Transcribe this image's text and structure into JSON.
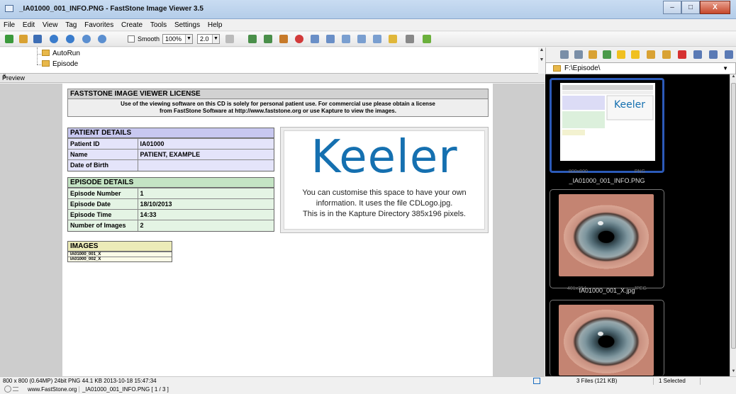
{
  "window": {
    "title": "_IA01000_001_INFO.PNG - FastStone Image Viewer 3.5",
    "min_label": "–",
    "max_label": "□",
    "close_label": "X"
  },
  "menu": [
    "File",
    "Edit",
    "View",
    "Tag",
    "Favorites",
    "Create",
    "Tools",
    "Settings",
    "Help"
  ],
  "toolbar": {
    "smooth_label": "Smooth",
    "zoom_value": "100%",
    "gamma_value": "2.0"
  },
  "tree": {
    "items": [
      "AutoRun",
      "Episode"
    ]
  },
  "preview": {
    "header": "Preview"
  },
  "license": {
    "title": "FASTSTONE IMAGE VIEWER LICENSE",
    "line1": "Use of the viewing software on this CD is solely for personal patient use. For commercial use please obtain a license",
    "line2": "from FastStone Software at http://www.faststone.org or use Kapture to view the images."
  },
  "patient": {
    "title": "PATIENT DETAILS",
    "rows": [
      {
        "k": "Patient ID",
        "v": "IA01000"
      },
      {
        "k": "Name",
        "v": "PATIENT, EXAMPLE"
      },
      {
        "k": "Date of Birth",
        "v": ""
      }
    ]
  },
  "episode": {
    "title": "EPISODE DETAILS",
    "rows": [
      {
        "k": "Episode Number",
        "v": "1"
      },
      {
        "k": "Episode Date",
        "v": "18/10/2013"
      },
      {
        "k": "Episode Time",
        "v": "14:33"
      },
      {
        "k": "Number of Images",
        "v": "2"
      }
    ]
  },
  "images": {
    "title": "IMAGES",
    "rows": [
      "IA01000_001_X",
      "IA01000_002_X"
    ]
  },
  "logo_panel": {
    "logo": "Keeler",
    "line1": "You can customise this space to have your own",
    "line2": "information. It uses the file CDLogo.jpg.",
    "line3": "This is in the Kapture Directory 385x196 pixels."
  },
  "status": {
    "image_info": "800 x 800 (0.64MP)  24bit PNG  44.1 KB  2013-10-18 15:47:34",
    "url": "www.FastStone.org",
    "file_info": "_IA01000_001_INFO.PNG [ 1 / 3 ]",
    "files": "3 Files (121 KB)",
    "selected": "1 Selected"
  },
  "browser": {
    "path": "F:\\Episode\\"
  },
  "thumbnails": [
    {
      "dims": "800x800",
      "type": "PNG",
      "name": "_IA01000_001_INFO.PNG"
    },
    {
      "dims": "401x354",
      "type": "JPEG",
      "name": "IA01000_001_X.jpg"
    },
    {
      "dims": "",
      "type": "",
      "name": ""
    }
  ]
}
